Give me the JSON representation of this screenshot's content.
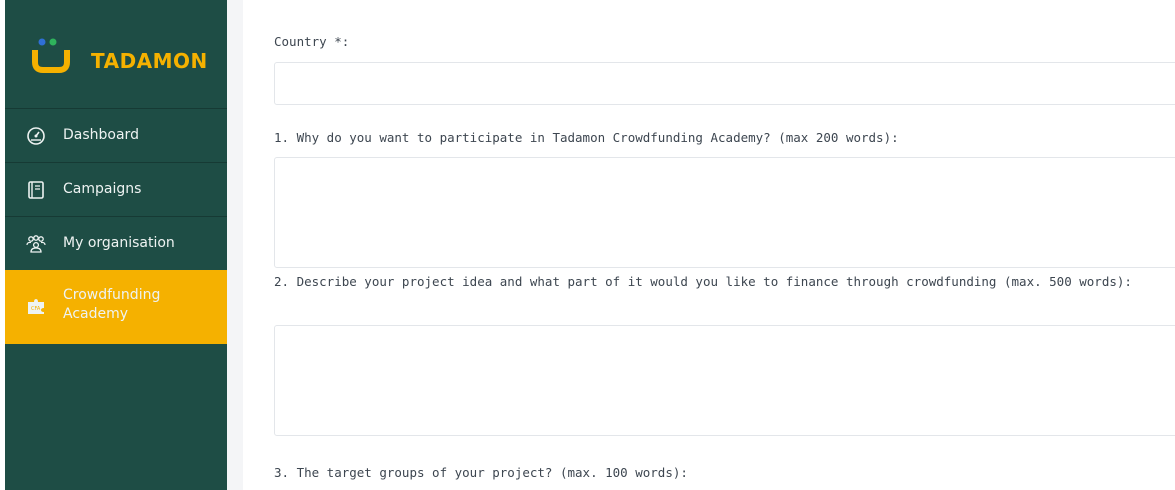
{
  "brand": {
    "name": "TADAMON",
    "accent": "#f5b100",
    "sidebar_bg": "#1e4d45"
  },
  "sidebar": {
    "items": [
      {
        "label": "Dashboard",
        "icon": "dashboard-gauge-icon"
      },
      {
        "label": "Campaigns",
        "icon": "notebook-icon"
      },
      {
        "label": "My organisation",
        "icon": "people-group-icon"
      },
      {
        "label": "Crowdfunding Academy",
        "icon": "academy-puzzle-icon",
        "active": true
      }
    ]
  },
  "form": {
    "country_label": "Country *:",
    "country_value": "",
    "q1_label": "1. Why do you want to participate in Tadamon Crowdfunding Academy? (max 200 words):",
    "q2_label": "2. Describe your project idea and what part of it would you like to finance through crowdfunding (max. 500 words):",
    "q3_label": "3. The target groups of your project? (max. 100 words):"
  }
}
